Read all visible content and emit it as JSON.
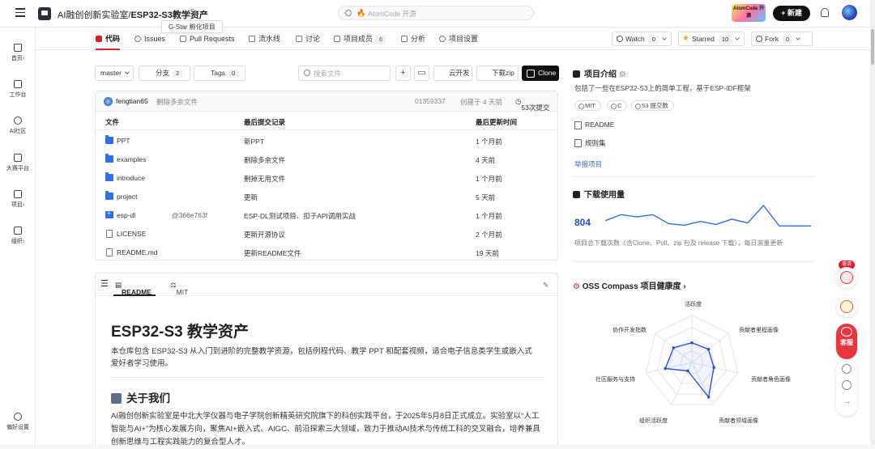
{
  "header": {
    "org": "AI融创创新实验室",
    "repo": "ESP32-S3教学资产",
    "tooltip": "G-Star 孵化项目",
    "search_placeholder": "AtomCode 开源",
    "badge_text": "AtomCode 开源",
    "new_label": "新建"
  },
  "sidebar": {
    "items": [
      {
        "label": "首页"
      },
      {
        "label": "工作台"
      },
      {
        "label": "AI社区"
      },
      {
        "label": "大赛平台"
      },
      {
        "label": "项目"
      },
      {
        "label": "组织"
      }
    ],
    "settings_label": "偏好设置"
  },
  "tabs": [
    {
      "label": "代码"
    },
    {
      "label": "Issues"
    },
    {
      "label": "Pull Requests"
    },
    {
      "label": "流水线"
    },
    {
      "label": "讨论"
    },
    {
      "label": "项目成员",
      "count": "6"
    },
    {
      "label": "分析"
    },
    {
      "label": "项目设置"
    }
  ],
  "actions": {
    "watch": {
      "label": "Watch",
      "count": "0"
    },
    "star": {
      "label": "Starred",
      "count": "10"
    },
    "fork": {
      "label": "Fork",
      "count": "0"
    }
  },
  "toolbar": {
    "branch": "master",
    "branches_label": "分支",
    "branches_count": "2",
    "tags_label": "Tags",
    "tags_count": "0",
    "file_search_placeholder": "搜索文件",
    "cloud_dev": "云开发",
    "download_zip": "下载zip",
    "clone": "Clone"
  },
  "commit": {
    "author": "fengtian65",
    "message": "删除多余文件",
    "hash": "01359337",
    "time": "创建于 4 天前",
    "count": "53次提交"
  },
  "file_table": {
    "headers": [
      "文件",
      "最后提交记录",
      "最后更新时间"
    ],
    "rows": [
      {
        "name": "PPT",
        "ref": "",
        "commit": "新PPT",
        "time": "1 个月前",
        "type": "folder"
      },
      {
        "name": "examples",
        "ref": "",
        "commit": "删除多余文件",
        "time": "4 天前",
        "type": "folder"
      },
      {
        "name": "introduce",
        "ref": "",
        "commit": "删掉无用文件",
        "time": "1 个月前",
        "type": "folder"
      },
      {
        "name": "project",
        "ref": "",
        "commit": "更新",
        "time": "5 天前",
        "type": "folder"
      },
      {
        "name": "esp-dl",
        "ref": "@366e763f",
        "commit": "ESP-DL测试项目、扣子API调用实战",
        "time": "1 个月前",
        "type": "submodule"
      },
      {
        "name": "LICENSE",
        "ref": "",
        "commit": "更新开源协议",
        "time": "2 个月前",
        "type": "file"
      },
      {
        "name": "README.md",
        "ref": "",
        "commit": "更新README文件",
        "time": "19 天前",
        "type": "file"
      }
    ]
  },
  "readme": {
    "tab_readme": "README",
    "tab_license": "MIT",
    "title": "ESP32-S3 教学资产",
    "intro": "本仓库包含 ESP32-S3 从入门到进阶的完整教学资源，包括例程代码、教学 PPT 和配套视频，适合电子信息类学生或嵌入式爱好者学习使用。",
    "about_heading": "关于我们",
    "about_text": "AI融创创新实验室是中北大学仪器与电子学院创新精英研究院旗下的科创实践平台，于2025年5月8日正式成立。实验室以“人工智能与AI+”为核心发展方向，聚焦AI+嵌入式、AIGC、前沿探索三大领域，致力于推动AI技术与传统工科的交叉融合，培养兼具创新思维与工程实践能力的复合型人才。"
  },
  "intro_panel": {
    "title": "项目介绍",
    "desc": "包括了一些在ESP32-S3上的简单工程，基于ESP-IDF框架",
    "chips": [
      "MIT",
      "C",
      "53 提交数"
    ],
    "readme_link": "README",
    "rules_link": "规则集",
    "report": "举报项目"
  },
  "downloads": {
    "title": "下载使用量",
    "total": "804",
    "note": "项目总下载次数（含Clone、Pull、zip 包及 release 下载），每日滚量更新",
    "sparkline": [
      12,
      20,
      17,
      20,
      8,
      6,
      11,
      7,
      14,
      9,
      32,
      5,
      5,
      5
    ]
  },
  "compass": {
    "title": "OSS Compass 项目健康度",
    "labels": [
      "活跃度",
      "贡献者里程画像",
      "贡献者角色画像",
      "贡献者领域画像",
      "组织活跃度",
      "社区服务与支持",
      "协作开发指数"
    ],
    "values": [
      0.42,
      0.45,
      0.48,
      0.82,
      0.2,
      0.58,
      0.5
    ]
  },
  "floating": {
    "invite": "邀请",
    "service": "客服"
  },
  "colors": {
    "accent_red": "#d6232b",
    "link_blue": "#2f6fe8",
    "chart_blue": "#1f4fd1"
  }
}
